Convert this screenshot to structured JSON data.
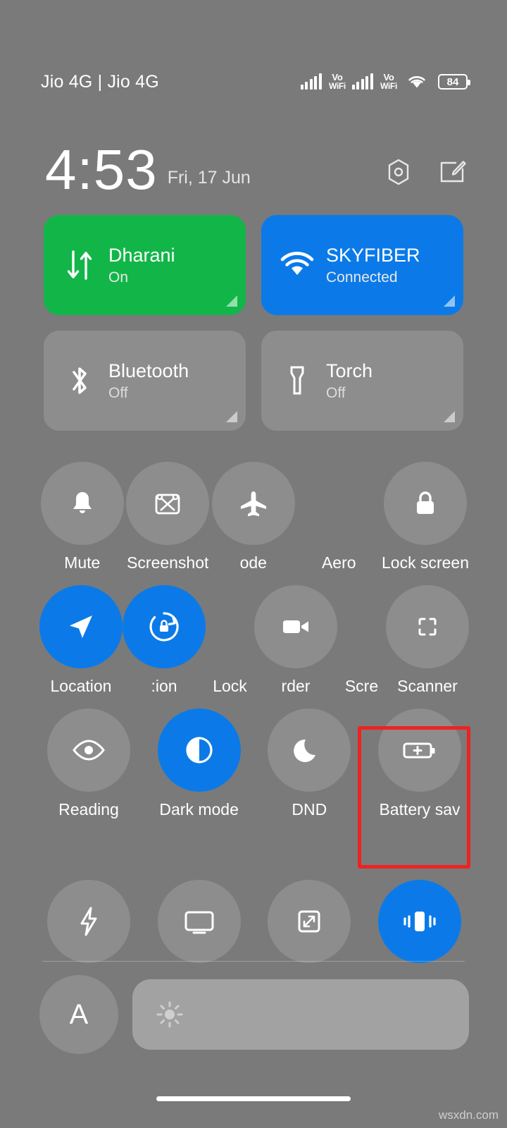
{
  "statusbar": {
    "carrier": "Jio 4G | Jio 4G",
    "volte_label_top": "Vo",
    "volte_label_bottom": "WiFi",
    "battery_percent": "84",
    "icons": [
      "signal-icon",
      "volte-icon",
      "signal-icon",
      "volte-icon",
      "wifi-icon",
      "battery-icon"
    ]
  },
  "clock": {
    "time": "4:53",
    "date": "Fri, 17 Jun",
    "settings_icon": "gear-icon",
    "edit_icon": "edit-icon"
  },
  "big_tiles": [
    {
      "title": "Dharani",
      "subtitle": "On",
      "icon": "data-transfer-icon",
      "state": "green"
    },
    {
      "title": "SKYFIBER",
      "subtitle": "Connected",
      "icon": "wifi-icon",
      "state": "blue"
    },
    {
      "title": "Bluetooth",
      "subtitle": "Off",
      "icon": "bluetooth-icon",
      "state": "grey"
    },
    {
      "title": "Torch",
      "subtitle": "Off",
      "icon": "flashlight-icon",
      "state": "grey"
    }
  ],
  "circle_rows": [
    [
      {
        "label": "Mute",
        "icon": "bell-icon",
        "on": false
      },
      {
        "label": "Screenshot",
        "icon": "screenshot-icon",
        "on": false
      },
      {
        "label": "ode",
        "icon": "airplane-icon",
        "on": false
      },
      {
        "label": "Aero",
        "icon": "spacer-icon",
        "on": false,
        "spacer": true
      },
      {
        "label": "Lock screen",
        "icon": "lock-icon",
        "on": false
      }
    ],
    [
      {
        "label": "Location",
        "icon": "location-arrow-icon",
        "on": true
      },
      {
        "label": ":ion",
        "icon": "rotation-lock-icon",
        "on": true
      },
      {
        "label": "Lock",
        "icon": "spacer-icon",
        "on": false,
        "spacer": true
      },
      {
        "label": "rder",
        "icon": "video-camera-icon",
        "on": false
      },
      {
        "label": "Scre",
        "icon": "spacer-icon",
        "on": false,
        "spacer": true
      },
      {
        "label": "Scanner",
        "icon": "scan-frame-icon",
        "on": false
      }
    ],
    [
      {
        "label": "Reading",
        "icon": "eye-icon",
        "on": false
      },
      {
        "label": "Dark mode",
        "icon": "contrast-circle-icon",
        "on": true
      },
      {
        "label": "DND",
        "icon": "moon-icon",
        "on": false
      },
      {
        "label": "Battery sav",
        "icon": "battery-plus-icon",
        "on": false,
        "highlighted": true
      }
    ]
  ],
  "bottom_row": [
    {
      "icon": "lightning-icon",
      "on": false
    },
    {
      "icon": "cast-screen-icon",
      "on": false
    },
    {
      "icon": "resize-icon",
      "on": false
    },
    {
      "icon": "vibrate-icon",
      "on": true
    }
  ],
  "brightness": {
    "auto_label": "A",
    "slider_icon": "sun-icon"
  },
  "watermark": "wsxdn.com",
  "colors": {
    "accent_blue": "#0b7ae8",
    "green": "#12b648",
    "tile_grey": "#8d8d8d",
    "highlight_red": "#ee2222"
  }
}
